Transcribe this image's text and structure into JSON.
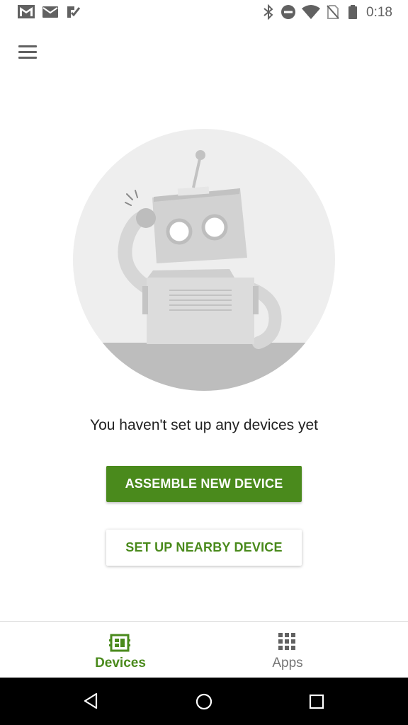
{
  "status_bar": {
    "time": "0:18",
    "icons": [
      "gmail-icon",
      "mail-icon",
      "tasks-icon",
      "bluetooth-icon",
      "do-not-disturb-icon",
      "wifi-icon",
      "no-sim-icon",
      "battery-icon"
    ]
  },
  "header": {
    "menu_icon": "hamburger-menu-icon"
  },
  "empty_state": {
    "illustration": "robot-illustration",
    "message": "You haven't set up any devices yet"
  },
  "actions": {
    "primary_label": "ASSEMBLE NEW DEVICE",
    "secondary_label": "SET UP NEARBY DEVICE"
  },
  "bottom_nav": {
    "tabs": [
      {
        "label": "Devices",
        "icon": "devices-icon",
        "active": true
      },
      {
        "label": "Apps",
        "icon": "apps-grid-icon",
        "active": false
      }
    ]
  },
  "system_nav": {
    "icons": [
      "back-icon",
      "home-icon",
      "recents-icon"
    ]
  },
  "colors": {
    "accent": "#4a8a1c",
    "inactive": "#757575",
    "illustration_bg": "#eeeeee",
    "illustration_ground": "#bdbdbd"
  }
}
